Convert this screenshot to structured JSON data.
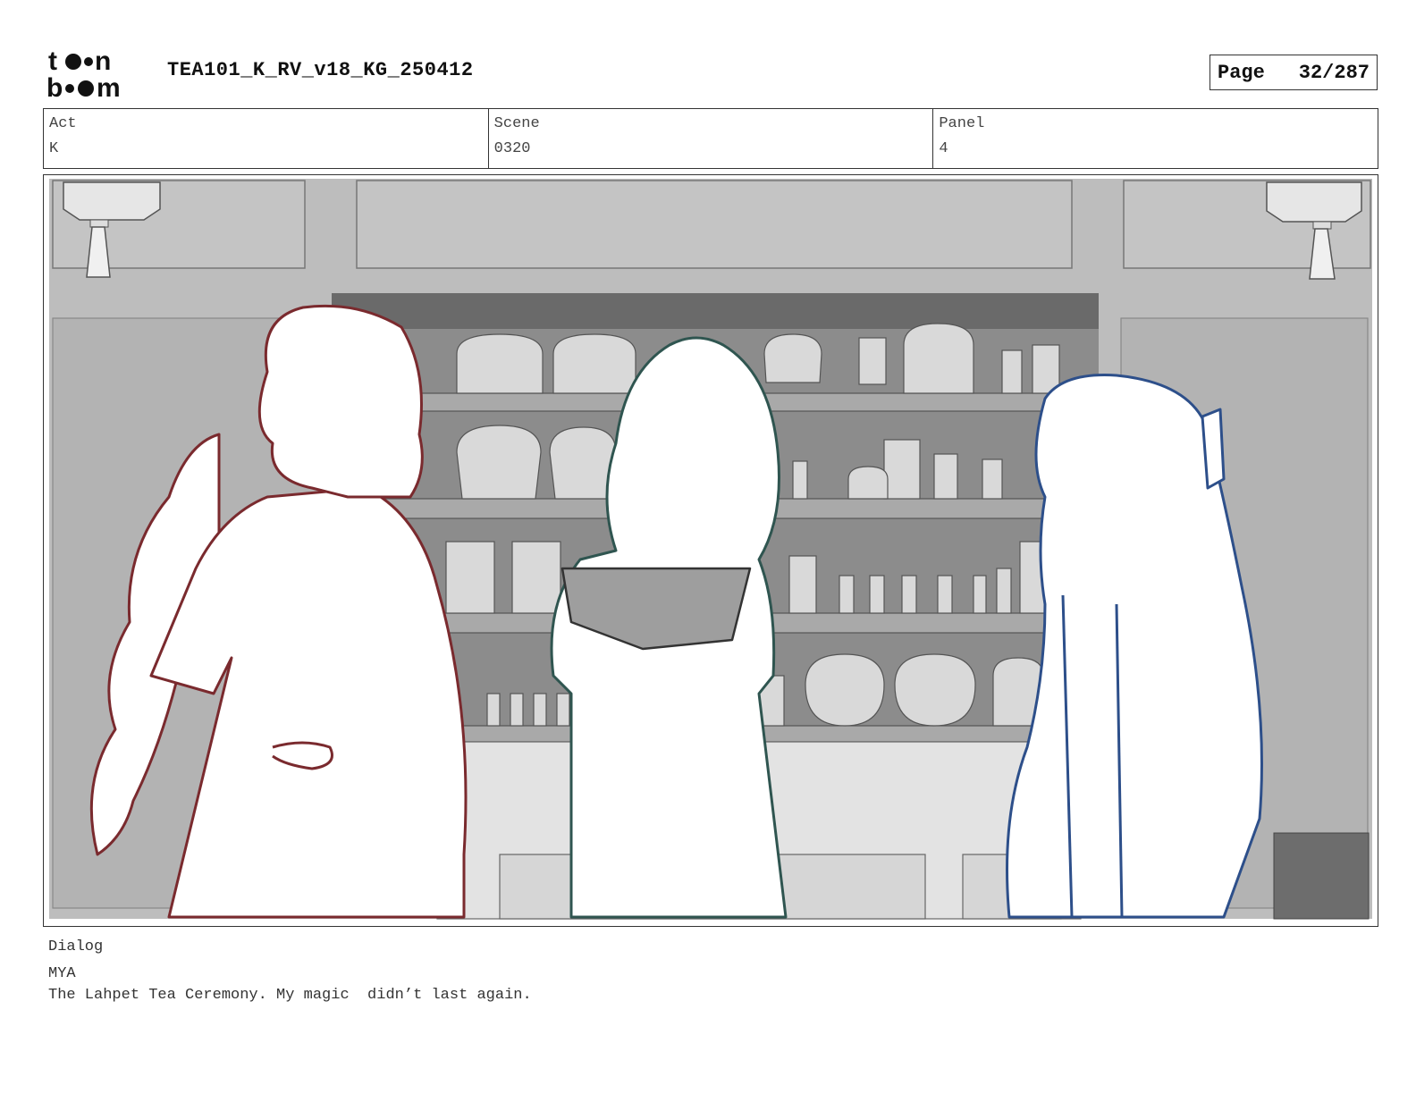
{
  "header": {
    "logo_alt": "toon boom",
    "title": "TEA101_K_RV_v18_KG_250412",
    "page_label": "Page",
    "page_number": "32/287"
  },
  "info": {
    "act_label": "Act",
    "act_value": "K",
    "scene_label": "Scene",
    "scene_value": "0320",
    "panel_label": "Panel",
    "panel_value": "4"
  },
  "panel": {
    "colors": {
      "left_character": "#7a2a2e",
      "center_character": "#2f5550",
      "right_character": "#2d4f8a",
      "background_gray": "#9a9a9a"
    }
  },
  "dialog": {
    "label": "Dialog",
    "speaker": "MYA",
    "line": "The Lahpet Tea Ceremony. My magic  didn’t last again."
  }
}
